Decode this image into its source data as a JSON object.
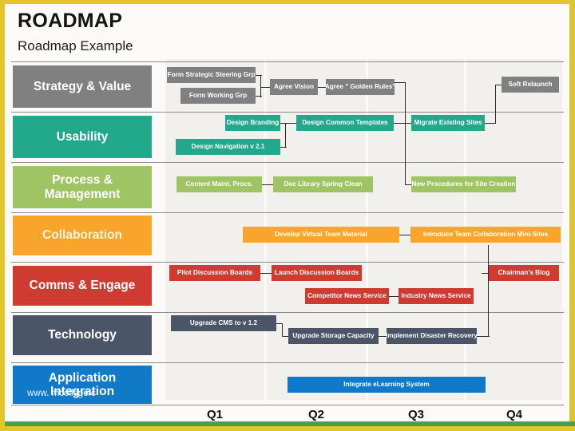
{
  "header": {
    "title": "ROADMAP",
    "subtitle": "Roadmap Example"
  },
  "watermark": {
    "text": "www.                      mcollege.c"
  },
  "quarters": {
    "labels": [
      "Q1",
      "Q2",
      "Q3",
      "Q4"
    ]
  },
  "colors": {
    "strategy": "#808080",
    "usability": "#22a88b",
    "process": "#9fc463",
    "collaboration": "#f9a52b",
    "comms": "#d03b31",
    "technology": "#4a5568",
    "application": "#1079c8",
    "frame_yellow": "#e2c62c",
    "frame_green": "#4e9e4e",
    "column_bg": "#f2f0ed",
    "lane_divider": "#8c8c8c",
    "connector": "#2b2b2b"
  },
  "lanes": [
    {
      "id": "strategy",
      "label": "Strategy & Value",
      "color": "#808080",
      "label_color": "#ffffff",
      "tasks": [
        {
          "id": "form-strategic-steering-grp",
          "label": "Form Strategic Steering Grp"
        },
        {
          "id": "form-working-grp",
          "label": "Form Working Grp"
        },
        {
          "id": "agree-vision",
          "label": "Agree Vision"
        },
        {
          "id": "agree-golden-rules",
          "label": "Agree \" Golden Rules\""
        },
        {
          "id": "soft-relaunch",
          "label": "Soft Relaunch"
        }
      ]
    },
    {
      "id": "usability",
      "label": "Usability",
      "color": "#22a88b",
      "label_color": "#ffffff",
      "tasks": [
        {
          "id": "design-branding",
          "label": "Design Branding"
        },
        {
          "id": "design-common-templates",
          "label": "Design Common Templates"
        },
        {
          "id": "migrate-existing-sites",
          "label": "Migrate Existing Sites"
        },
        {
          "id": "design-navigation-v21",
          "label": "Design Navigation v 2.1"
        }
      ]
    },
    {
      "id": "process",
      "label": "Process & Management",
      "color": "#9fc463",
      "label_color": "#ffffff",
      "tasks": [
        {
          "id": "content-maint-procs",
          "label": "Content Maint. Procs."
        },
        {
          "id": "doc-library-spring-clean",
          "label": "Doc Library Spring Clean"
        },
        {
          "id": "new-procedures-for-site-creation",
          "label": "New Procedures for Site Creation"
        }
      ]
    },
    {
      "id": "collaboration",
      "label": "Collaboration",
      "color": "#f9a52b",
      "label_color": "#fff4dd",
      "tasks": [
        {
          "id": "develop-virtual-team-material",
          "label": "Develop Virtual Team Material"
        },
        {
          "id": "introduce-team-collaboration-mini-sites",
          "label": "Introduce Team Collaboration Mini-Sites"
        }
      ]
    },
    {
      "id": "comms",
      "label": "Comms & Engage",
      "color": "#d03b31",
      "label_color": "#ffffff",
      "tasks": [
        {
          "id": "pilot-discussion-boards",
          "label": "Pilot Discussion Boards"
        },
        {
          "id": "launch-discussion-boards",
          "label": "Launch Discussion Boards"
        },
        {
          "id": "chairmans-blog",
          "label": "Chairman's Blog"
        },
        {
          "id": "competitor-news-service",
          "label": "Competitor News Service"
        },
        {
          "id": "industry-news-service",
          "label": "Industry News Service"
        }
      ]
    },
    {
      "id": "technology",
      "label": "Technology",
      "color": "#4a5568",
      "label_color": "#ffffff",
      "tasks": [
        {
          "id": "upgrade-cms-to-v12",
          "label": "Upgrade CMS to v 1.2"
        },
        {
          "id": "upgrade-storage-capacity",
          "label": "Upgrade Storage Capacity"
        },
        {
          "id": "implement-disaster-recovery",
          "label": "Implement Disaster Recovery"
        }
      ]
    },
    {
      "id": "application",
      "label": "Application Integration",
      "color": "#1079c8",
      "label_color": "#ffffff",
      "tasks": [
        {
          "id": "integrate-elearning-system",
          "label": "Integrate eLearning System"
        }
      ]
    }
  ]
}
